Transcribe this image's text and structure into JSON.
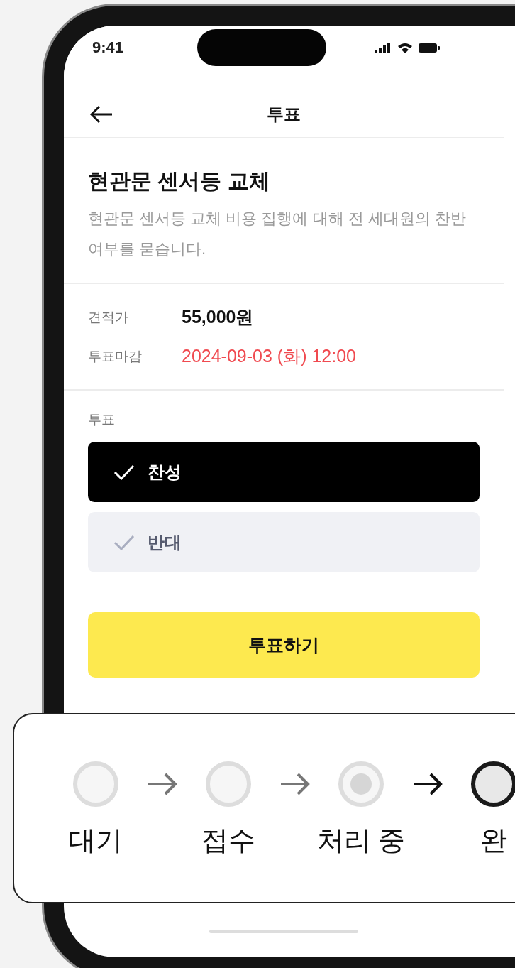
{
  "status_bar": {
    "time": "9:41"
  },
  "header": {
    "title": "투표"
  },
  "proposal": {
    "title": "현관문 센서등 교체",
    "description": "현관문 센서등 교체 비용 집행에 대해 전 세대원의 찬반여부를 묻습니다."
  },
  "details": [
    {
      "label": "견적가",
      "value": "55,000원",
      "kind": "amount"
    },
    {
      "label": "투표마감",
      "value": "2024-09-03 (화) 12:00",
      "kind": "deadline"
    }
  ],
  "vote": {
    "label": "투표",
    "options": [
      {
        "label": "찬성",
        "selected": true
      },
      {
        "label": "반대",
        "selected": false
      }
    ],
    "submit": "투표하기"
  },
  "progress_steps": [
    {
      "label": "대기",
      "kind": "pending"
    },
    {
      "label": "접수",
      "kind": "pending"
    },
    {
      "label": "처리 중",
      "kind": "active"
    },
    {
      "label": "완",
      "kind": "done"
    }
  ]
}
